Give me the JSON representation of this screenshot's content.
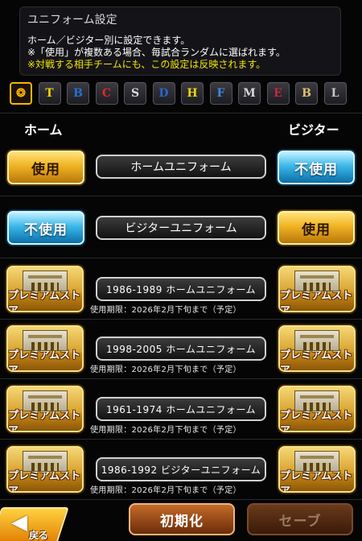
{
  "header": {
    "title": "ユニフォーム設定",
    "line1": "ホーム／ビジター別に設定できます。",
    "line2": "※「使用」が複数ある場合、毎試合ランダムに選ばれます。",
    "line3": "※対戦する相手チームにも、この設定は反映されます。"
  },
  "teams": [
    {
      "icon": "hawk-shield-icon",
      "glyph": "❂",
      "color": "#ffb300",
      "active": true
    },
    {
      "icon": "tigers-logo-icon",
      "glyph": "T",
      "color": "#f2d200"
    },
    {
      "icon": "baystars-logo-icon",
      "glyph": "B",
      "color": "#2a6fd0"
    },
    {
      "icon": "carp-logo-icon",
      "glyph": "C",
      "color": "#e3262a"
    },
    {
      "icon": "swallows-logo-icon",
      "glyph": "S",
      "color": "#d8d8d8"
    },
    {
      "icon": "dragons-logo-icon",
      "glyph": "D",
      "color": "#2a66c8"
    },
    {
      "icon": "hawks-logo-icon",
      "glyph": "H",
      "color": "#f2d200"
    },
    {
      "icon": "fighters-logo-icon",
      "glyph": "F",
      "color": "#3a8ad8"
    },
    {
      "icon": "marines-logo-icon",
      "glyph": "M",
      "color": "#d8d8d8"
    },
    {
      "icon": "eagles-logo-icon",
      "glyph": "E",
      "color": "#c8283a"
    },
    {
      "icon": "buffaloes-logo-icon",
      "glyph": "B",
      "color": "#e0c070"
    },
    {
      "icon": "lions-logo-icon",
      "glyph": "L",
      "color": "#c8c8c8"
    }
  ],
  "columns": {
    "home": "ホーム",
    "visitor": "ビジター"
  },
  "rows": [
    {
      "uniform": "ホームユニフォーム",
      "home_status": "使用",
      "visitor_status": "不使用"
    },
    {
      "uniform": "ビジターユニフォーム",
      "home_status": "不使用",
      "visitor_status": "使用"
    },
    {
      "uniform": "1986-1989 ホームユニフォーム",
      "period": "使用期限：2026年2月下旬まで（予定）",
      "store": "プレミアムストア"
    },
    {
      "uniform": "1998-2005 ホームユニフォーム",
      "period": "使用期限：2026年2月下旬まで（予定）",
      "store": "プレミアムストア"
    },
    {
      "uniform": "1961-1974 ホームユニフォーム",
      "period": "使用期限：2026年2月下旬まで（予定）",
      "store": "プレミアムストア"
    },
    {
      "uniform": "1986-1992 ビジターユニフォーム",
      "period": "使用期限：2026年2月下旬まで（予定）",
      "store": "プレミアムストア"
    }
  ],
  "footer": {
    "back": "戻る",
    "reset": "初期化",
    "save": "セーブ"
  }
}
